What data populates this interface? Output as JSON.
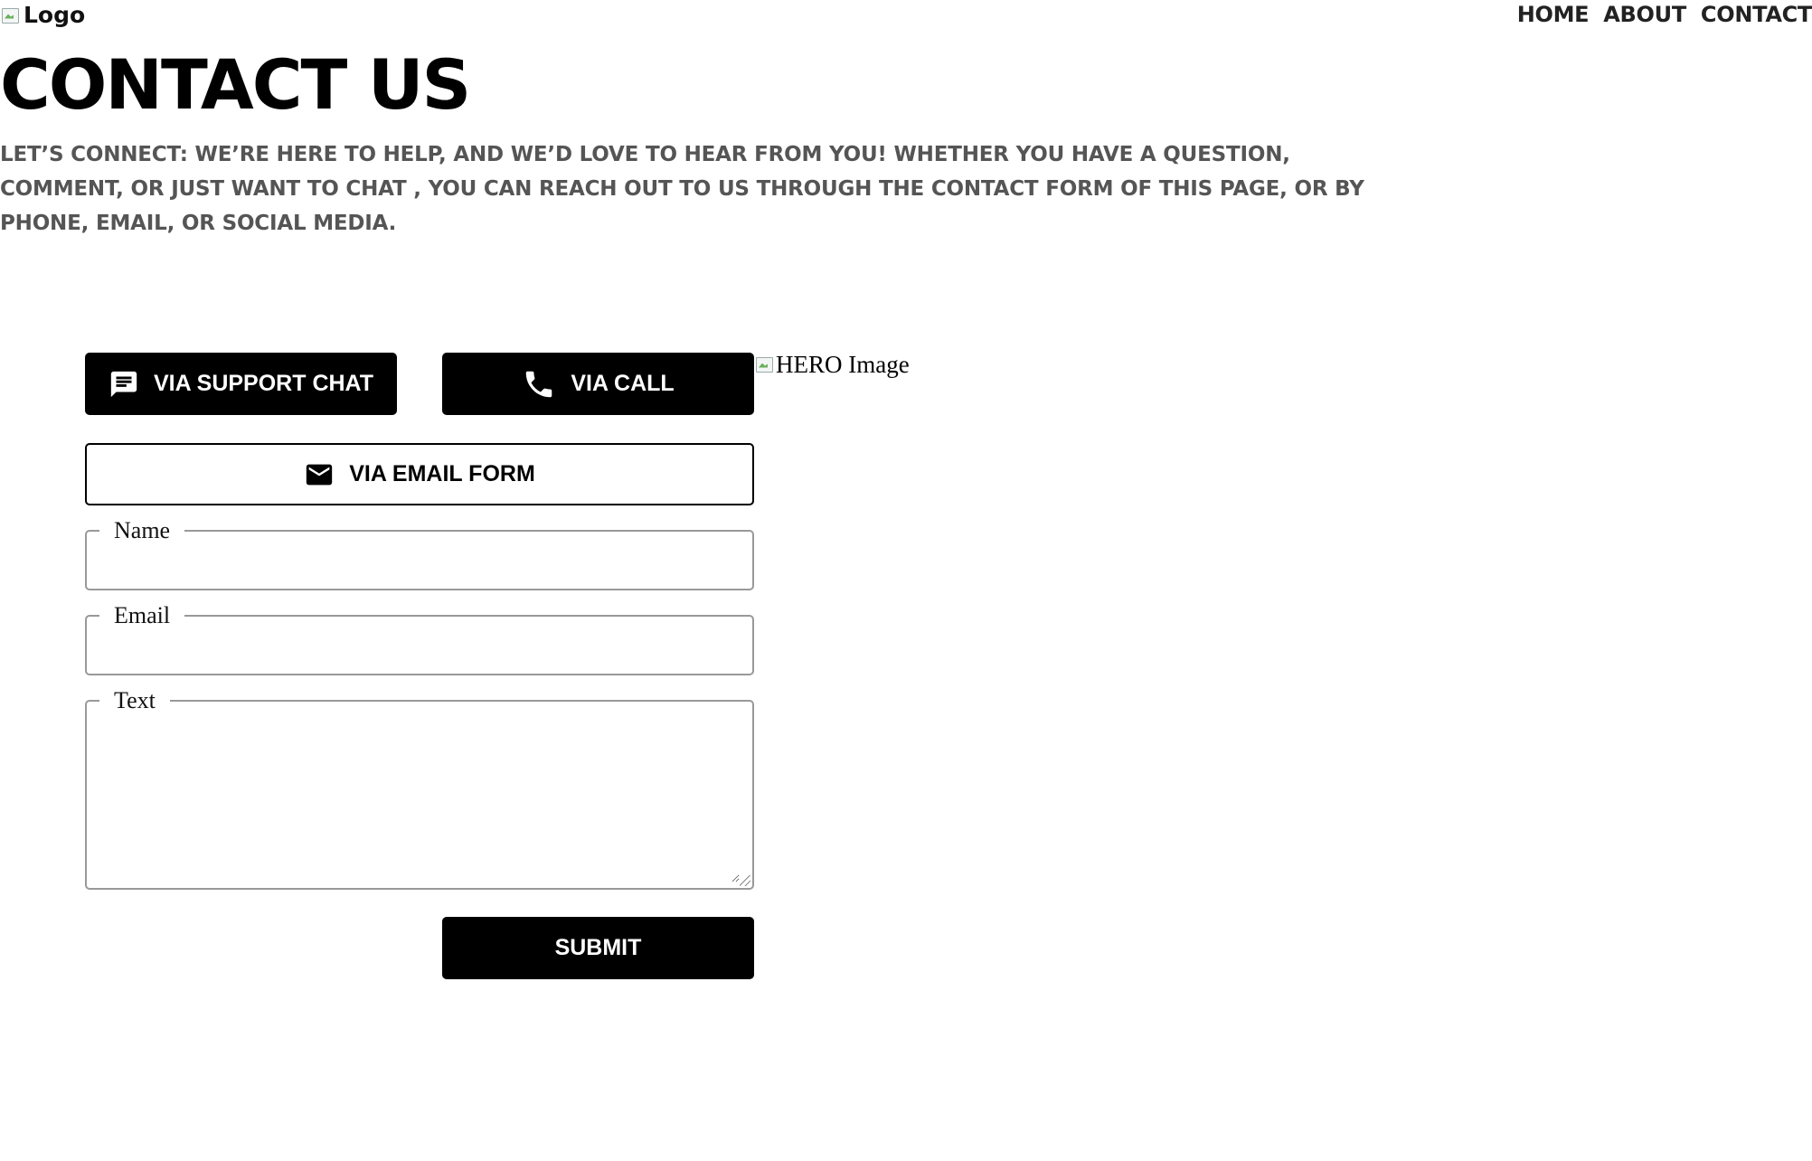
{
  "header": {
    "logo_alt": "Logo",
    "nav": [
      "HOME",
      "ABOUT",
      "CONTACT"
    ]
  },
  "hero_section": {
    "title": "CONTACT US",
    "intro": "LET’S CONNECT: WE’RE HERE TO HELP, AND WE’D LOVE TO HEAR FROM YOU! WHETHER YOU HAVE A QUESTION, COMMENT, OR JUST WANT TO CHAT , YOU CAN REACH OUT TO US THROUGH THE CONTACT FORM OF THIS PAGE, OR BY PHONE, EMAIL, OR SOCIAL MEDIA."
  },
  "contact_options": {
    "support_chat_label": "VIA SUPPORT CHAT",
    "call_label": "VIA CALL",
    "email_form_label": "VIA EMAIL FORM",
    "icons": [
      "chat-icon",
      "phone-icon",
      "mail-icon"
    ]
  },
  "form": {
    "name_label": "Name",
    "name_value": "",
    "email_label": "Email",
    "email_value": "",
    "text_label": "Text",
    "text_value": "",
    "submit_label": "SUBMIT"
  },
  "hero_image_alt": "HERO Image",
  "colors": {
    "button_dark": "#000000",
    "intro_text": "#555555",
    "border": "#999999"
  }
}
